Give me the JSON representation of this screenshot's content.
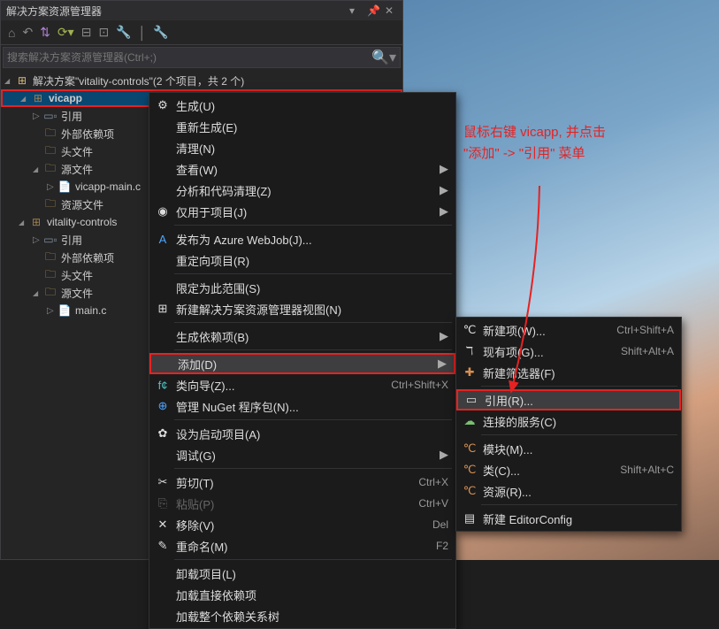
{
  "panel": {
    "title": "解决方案资源管理器",
    "search_placeholder": "搜索解决方案资源管理器(Ctrl+;)",
    "solution_label": "解决方案\"vitality-controls\"(2 个项目，共 2 个)",
    "project1": "vicapp",
    "project1_items": {
      "references": "引用",
      "external_deps": "外部依赖项",
      "headers": "头文件",
      "sources": "源文件",
      "source_file": "vicapp-main.c",
      "resources": "资源文件"
    },
    "project2": "vitality-controls",
    "project2_items": {
      "references": "引用",
      "external_deps": "外部依赖项",
      "headers": "头文件",
      "sources": "源文件",
      "source_file": "main.c"
    }
  },
  "menu1": [
    {
      "icon": "⚙",
      "label": "生成(U)"
    },
    {
      "label": "重新生成(E)"
    },
    {
      "label": "清理(N)"
    },
    {
      "label": "查看(W)",
      "sub": true
    },
    {
      "label": "分析和代码清理(Z)",
      "sub": true
    },
    {
      "icon": "◉",
      "label": "仅用于项目(J)",
      "sub": true
    },
    {
      "icon": "A",
      "ic": "ic-blue",
      "label": "发布为 Azure WebJob(J)...",
      "sep_before": true
    },
    {
      "label": "重定向项目(R)"
    },
    {
      "label": "限定为此范围(S)",
      "sep_before": true
    },
    {
      "icon": "⊞",
      "label": "新建解决方案资源管理器视图(N)"
    },
    {
      "label": "生成依赖项(B)",
      "sub": true,
      "sep_before": true
    },
    {
      "label": "添加(D)",
      "sub": true,
      "hl": true,
      "sep_before": true
    },
    {
      "icon": "f¢",
      "ic": "ic-cyan",
      "label": "类向导(Z)...",
      "short": "Ctrl+Shift+X"
    },
    {
      "icon": "⊕",
      "ic": "ic-blue",
      "label": "管理 NuGet 程序包(N)..."
    },
    {
      "icon": "✿",
      "label": "设为启动项目(A)",
      "sep_before": true
    },
    {
      "label": "调试(G)",
      "sub": true
    },
    {
      "icon": "✂",
      "label": "剪切(T)",
      "short": "Ctrl+X",
      "sep_before": true
    },
    {
      "icon": "⎘",
      "label": "粘贴(P)",
      "short": "Ctrl+V",
      "disabled": true
    },
    {
      "icon": "✕",
      "label": "移除(V)",
      "short": "Del"
    },
    {
      "icon": "✎",
      "label": "重命名(M)",
      "short": "F2"
    },
    {
      "label": "卸载项目(L)",
      "sep_before": true
    },
    {
      "label": "加载直接依赖项"
    },
    {
      "label": "加载整个依赖关系树"
    }
  ],
  "menu2": [
    {
      "icon": "℃",
      "label": "新建项(W)...",
      "short": "Ctrl+Shift+A"
    },
    {
      "icon": "ℸ",
      "label": "现有项(G)...",
      "short": "Shift+Alt+A"
    },
    {
      "icon": "✚",
      "ic": "ic-orange",
      "label": "新建筛选器(F)"
    },
    {
      "icon": "▭",
      "label": "引用(R)...",
      "hl": true,
      "sep_before": true
    },
    {
      "icon": "☁",
      "ic": "ic-green",
      "label": "连接的服务(C)"
    },
    {
      "icon": "℃",
      "ic": "ic-orange",
      "label": "模块(M)...",
      "sep_before": true
    },
    {
      "icon": "℃",
      "ic": "ic-orange",
      "label": "类(C)...",
      "short": "Shift+Alt+C"
    },
    {
      "icon": "℃",
      "ic": "ic-orange",
      "label": "资源(R)..."
    },
    {
      "icon": "▤",
      "label": "新建 EditorConfig",
      "sep_before": true
    }
  ],
  "annotation": {
    "line1": "鼠标右键 vicapp, 并点击",
    "line2": "\"添加\" -> \"引用\" 菜单"
  }
}
